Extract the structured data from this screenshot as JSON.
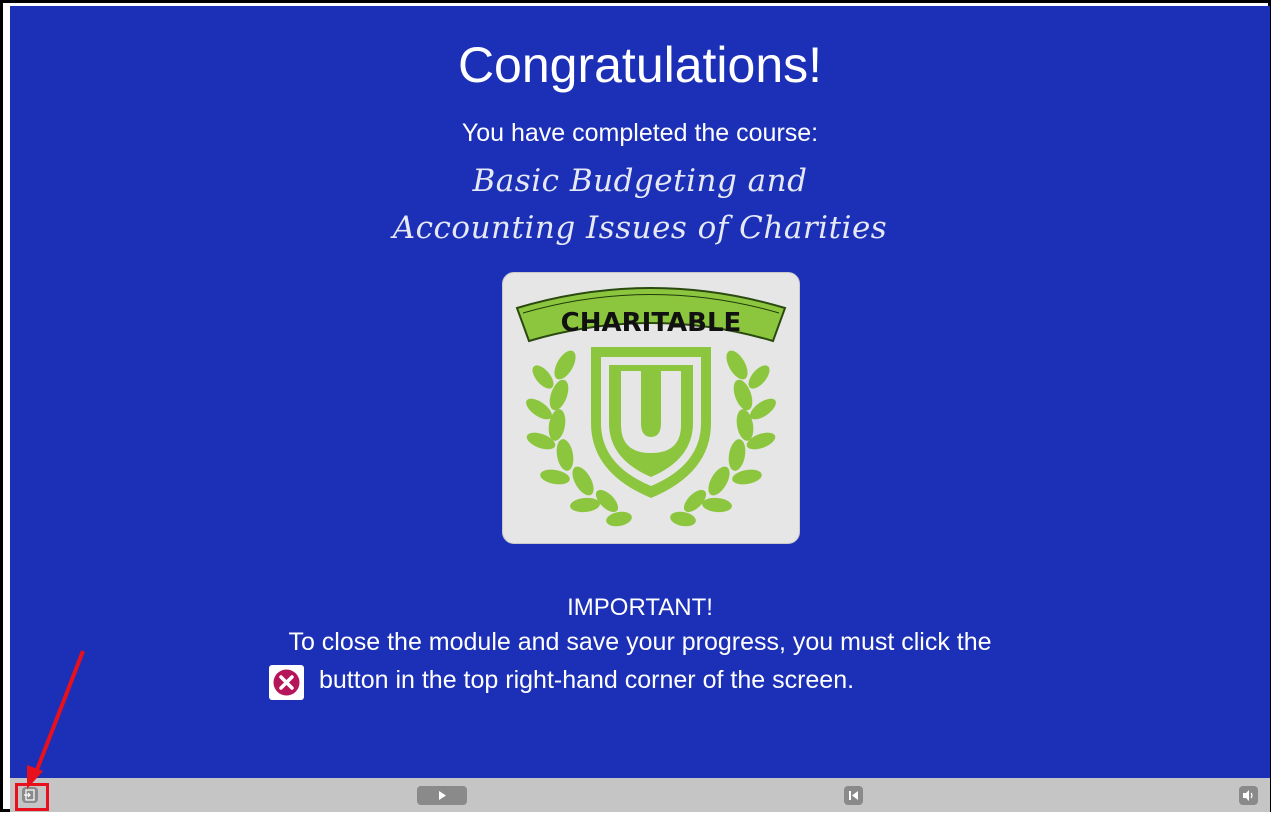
{
  "slide": {
    "title": "Congratulations!",
    "subtitle": "You have completed the course:",
    "course_line1": "Basic Budgeting and",
    "course_line2": "Accounting Issues of Charities",
    "logo_text": "CHARITABLE",
    "logo_letter": "U",
    "important": "IMPORTANT!",
    "instruction_line1": "To close the module and save your progress, you must click the",
    "instruction_line2": "button in the top right-hand corner of the screen.",
    "background_color": "#1b30b7",
    "logo_green": "#8cc63f"
  },
  "toolbar": {
    "exit_icon": "exit-icon",
    "play_icon": "play-icon",
    "rewind_icon": "rewind-icon",
    "volume_icon": "volume-icon"
  },
  "annotation": {
    "arrow_color": "#e8101c",
    "highlight_color": "#e8101c"
  }
}
